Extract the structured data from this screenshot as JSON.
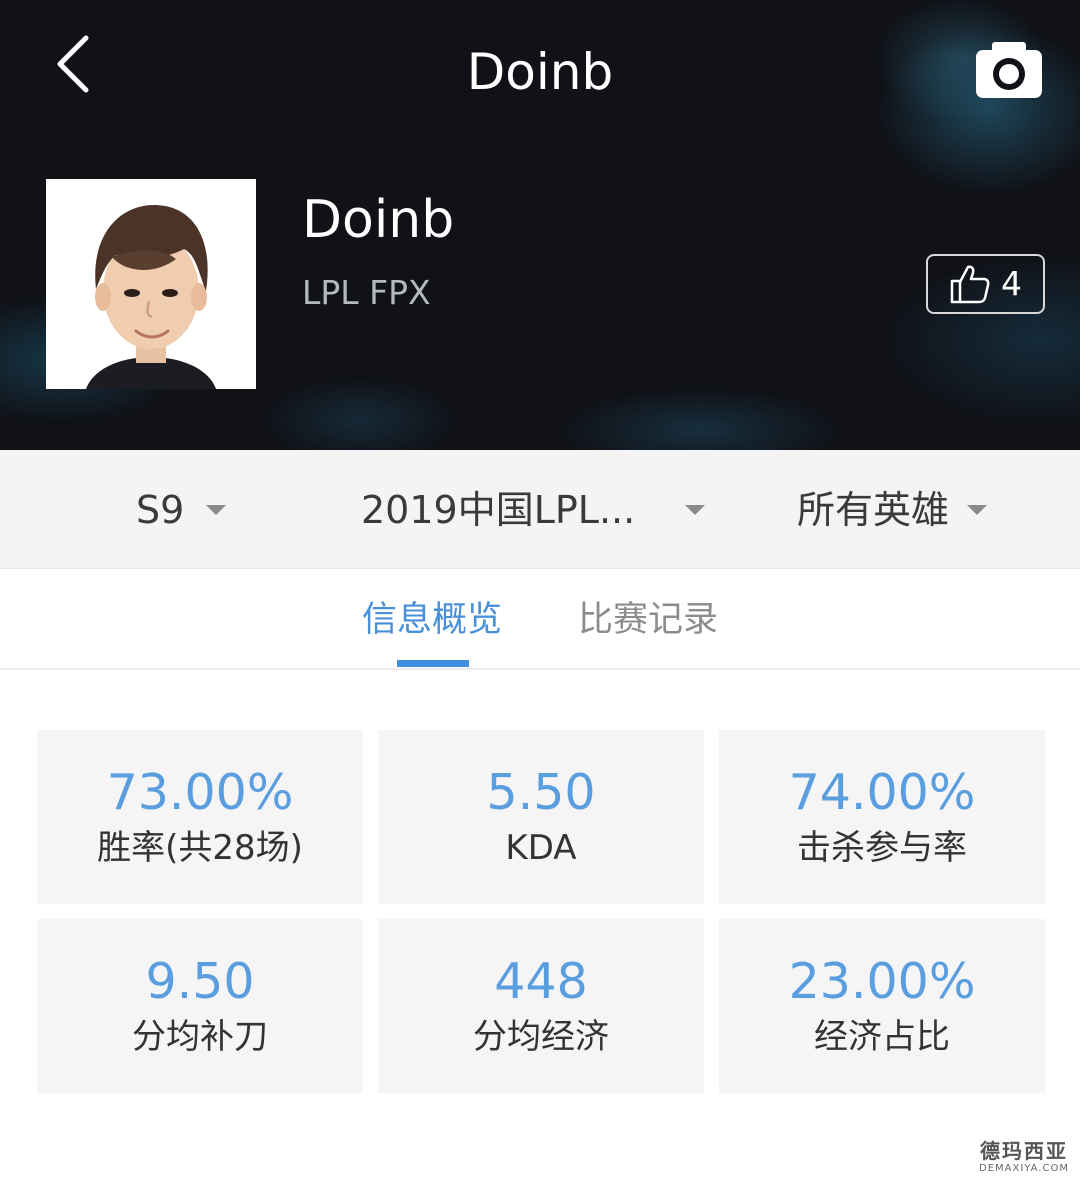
{
  "header": {
    "title": "Doinb",
    "player": {
      "name": "Doinb",
      "team": "LPL FPX",
      "likes": "4"
    }
  },
  "filters": [
    {
      "label": "S9"
    },
    {
      "label": "2019中国LPL..."
    },
    {
      "label": "所有英雄"
    }
  ],
  "tabs": [
    {
      "label": "信息概览",
      "active": true
    },
    {
      "label": "比赛记录",
      "active": false
    }
  ],
  "stats": [
    {
      "value": "73.00%",
      "label": "胜率(共28场)"
    },
    {
      "value": "5.50",
      "label": "KDA"
    },
    {
      "value": "74.00%",
      "label": "击杀参与率"
    },
    {
      "value": "9.50",
      "label": "分均补刀"
    },
    {
      "value": "448",
      "label": "分均经济"
    },
    {
      "value": "23.00%",
      "label": "经济占比"
    }
  ],
  "watermark": {
    "main": "德玛西亚",
    "sub": "DEMAXIYA.COM"
  },
  "icons": [
    "chevron-left-icon",
    "camera-icon",
    "thumbs-up-icon",
    "caret-down-icon"
  ],
  "colors": {
    "accent": "#4a90d9",
    "stat_value": "#5a9ee0",
    "header_bg": "#101218",
    "card_bg": "#f5f5f5"
  }
}
